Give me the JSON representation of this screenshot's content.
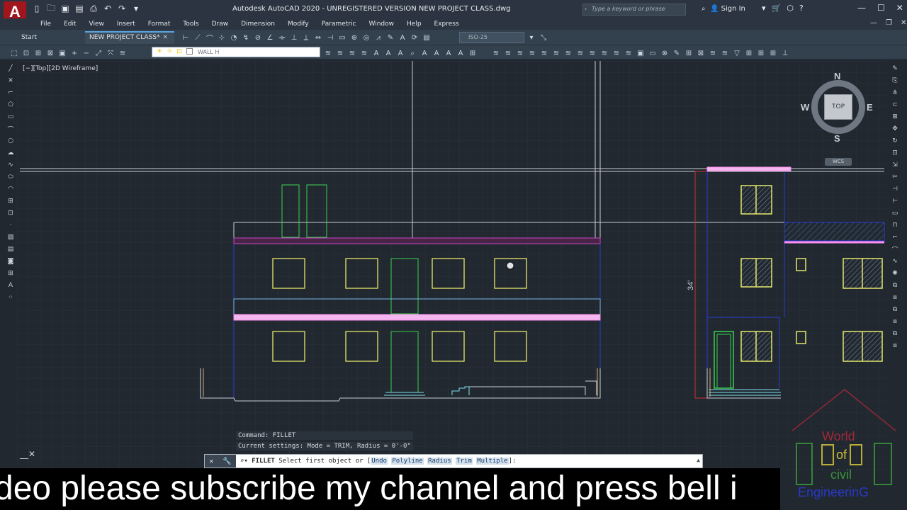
{
  "titlebar": {
    "app_logo": "A",
    "title": "Autodesk AutoCAD 2020 - UNREGISTERED VERSION    NEW PROJECT CLASS.dwg",
    "search_placeholder": "Type a keyword or phrase",
    "sign_in": "Sign In"
  },
  "menu": [
    "File",
    "Edit",
    "View",
    "Insert",
    "Format",
    "Tools",
    "Draw",
    "Dimension",
    "Modify",
    "Parametric",
    "Window",
    "Help",
    "Express"
  ],
  "tabs": {
    "start": "Start",
    "active": "NEW PROJECT CLASS*"
  },
  "toolbar": {
    "text_style": "ISO-25",
    "layer": "WALL H"
  },
  "viewport": {
    "label": "[−][Top][2D Wireframe]"
  },
  "viewcube": {
    "n": "N",
    "s": "S",
    "e": "E",
    "w": "W",
    "top": "TOP",
    "wcs": "WCS"
  },
  "drawing": {
    "dimension_text": "34'"
  },
  "command": {
    "history": [
      "Command:  FILLET",
      "Current settings: Mode = TRIM, Radius = 0'-0\""
    ],
    "prompt_cmd": "FILLET",
    "prompt_text": " Select first object or [",
    "options": [
      "Undo",
      "Polyline",
      "Radius",
      "Trim",
      "Multiple"
    ],
    "prompt_end": "]:"
  },
  "subtitle": "deo please subscribe my channel and press bell i",
  "watermark": {
    "line1": "World",
    "line2": "of",
    "line3": "civil",
    "line4": "EngineerinG"
  },
  "colors": {
    "canvas": "#212830",
    "grid": "#2b333d",
    "window": "#e6e86a",
    "door": "#3ccf4e",
    "slab": "#ff8ff0",
    "frame": "#2a3bd6",
    "wall": "#c9ced6",
    "dim": "#d42f2f",
    "water": "#7fe0ef"
  }
}
